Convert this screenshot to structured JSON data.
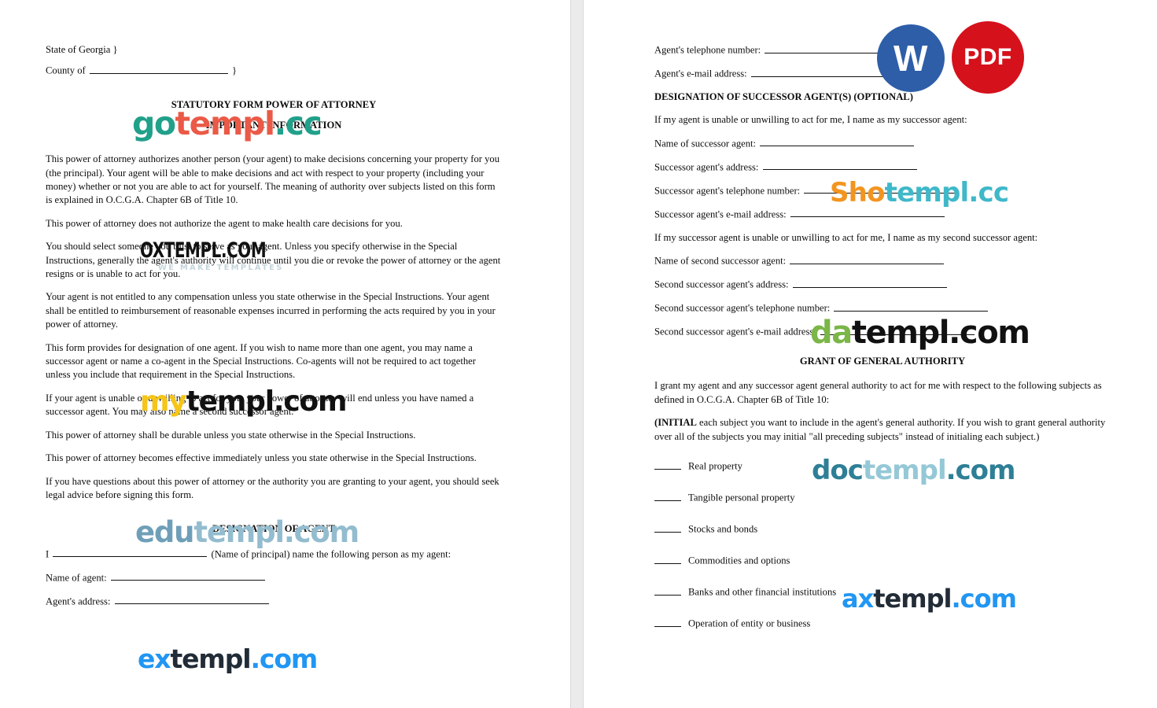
{
  "document": {
    "title": "STATUTORY FORM POWER OF ATTORNEY",
    "subtitle": "IMPORTANT INFORMATION"
  },
  "left_page": {
    "state_line": "State of Georgia }",
    "county_label": "County of",
    "county_suffix": "}",
    "paragraphs": [
      "This power of attorney authorizes another person (your agent) to make decisions concerning your property for you (the principal). Your agent will be able to make decisions and act with respect to your property (including your money) whether or not you are able to act for yourself. The meaning of authority over subjects listed on this form is explained in O.C.G.A. Chapter 6B of Title 10.",
      "This power of attorney does not authorize the agent to make health care decisions for you.",
      "You should select someone you trust to serve as your agent. Unless you specify otherwise in the Special Instructions, generally the agent's authority will continue until you die or revoke the power of attorney or the agent resigns or is unable to act for you.",
      "Your agent is not entitled to any compensation unless you state otherwise in the Special Instructions. Your agent shall be entitled to reimbursement of reasonable expenses incurred in performing the acts required by you in your power of attorney.",
      "This form provides for designation of one agent. If you wish to name more than one agent, you may name a successor agent or name a co-agent in the Special Instructions. Co-agents will not be required to act together unless you include that requirement in the Special Instructions.",
      "If your agent is unable or unwilling to act for you, your power of attorney will end unless you have named a successor agent. You may also name a second successor agent.",
      "This power of attorney shall be durable unless you state otherwise in the Special Instructions.",
      "This power of attorney becomes effective immediately unless you state otherwise in the Special Instructions.",
      "If you have questions about this power of attorney or the authority you are granting to your agent, you should seek legal advice before signing this form."
    ],
    "designation_heading": "DESIGNATION OF AGENT",
    "principal_prefix": "I",
    "principal_suffix": "(Name of principal) name the following person as my agent:",
    "agent_name_label": "Name of agent:",
    "agent_address_label": "Agent's address:"
  },
  "right_page": {
    "agent_phone_label": "Agent's telephone number:",
    "agent_email_label": "Agent's e-mail address:",
    "successor_heading": "DESIGNATION OF SUCCESSOR AGENT(S) (OPTIONAL)",
    "successor_intro": "If my agent is unable or unwilling to act for me, I name as my successor agent:",
    "successor_name_label": "Name of successor agent:",
    "successor_address_label": "Successor agent's address:",
    "successor_phone_label": "Successor agent's telephone number:",
    "successor_email_label": "Successor agent's e-mail address:",
    "second_successor_intro": "If my successor agent is unable or unwilling to act for me, I name as my second successor agent:",
    "second_name_label": "Name of second successor agent:",
    "second_address_label": "Second successor agent's address:",
    "second_phone_label": "Second successor agent's telephone number:",
    "second_email_label": "Second successor agent's e-mail address:",
    "grant_heading": "GRANT OF GENERAL AUTHORITY",
    "grant_intro": "I grant my agent and any successor agent general authority to act for me with respect to the following subjects as defined in O.C.G.A. Chapter 6B of Title 10:",
    "initial_bold": "(INITIAL",
    "initial_rest": " each subject you want to include in the agent's general authority. If you wish to grant general authority over all of the subjects you may initial \"all preceding subjects\" instead of initialing each subject.)",
    "subjects": [
      "Real property",
      "Tangible personal property",
      "Stocks and bonds",
      "Commodities and options",
      "Banks and other financial institutions",
      "Operation of entity or business"
    ]
  },
  "badges": {
    "word": {
      "label": "W",
      "color": "#2e5ea8"
    },
    "pdf": {
      "label": "PDF",
      "color": "#d5111c"
    }
  },
  "watermarks": {
    "gotempl": {
      "a": "go",
      "b": "templ",
      "c": ".cc"
    },
    "oxtempl": {
      "main": "OXTEMPL.COM",
      "sub": "WE MAKE TEMPLATES"
    },
    "mytempl": {
      "a": "my",
      "b": "templ.com"
    },
    "edutempl": {
      "a": "edu",
      "b": "templ.com"
    },
    "extempl": {
      "a": "ex",
      "b": "templ",
      "c": ".com"
    },
    "shotempl": {
      "a": "Sho",
      "b": "templ.cc"
    },
    "datempl": {
      "a": "da",
      "b": "templ.com"
    },
    "doctempl": {
      "a": "doc",
      "b": "templ",
      "c": ".com"
    },
    "axtempl": {
      "a": "ax",
      "b": "templ",
      "c": ".com"
    }
  }
}
